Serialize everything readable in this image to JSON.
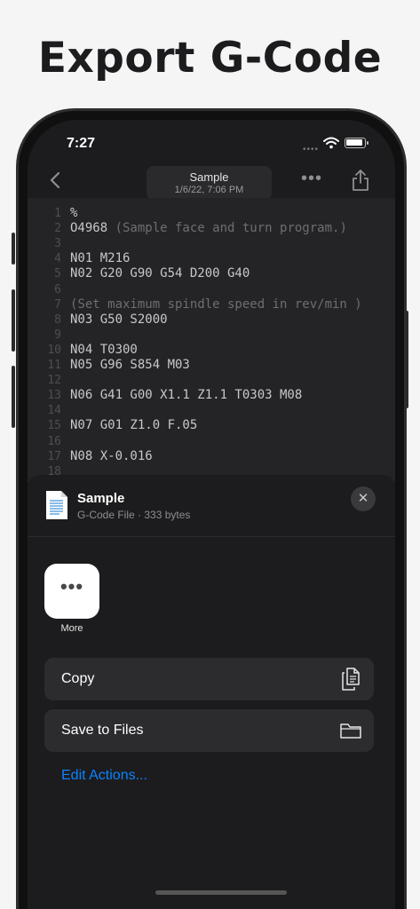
{
  "headline": "Export G-Code",
  "status": {
    "time": "7:27"
  },
  "nav": {
    "doc_title": "Sample",
    "doc_date": "1/6/22, 7:06 PM",
    "more": "•••"
  },
  "code_lines": [
    {
      "n": "1",
      "code": "%",
      "comment": ""
    },
    {
      "n": "2",
      "code": "O4968 ",
      "comment": "(Sample face and turn program.)"
    },
    {
      "n": "3",
      "code": "",
      "comment": ""
    },
    {
      "n": "4",
      "code": "N01 M216",
      "comment": ""
    },
    {
      "n": "5",
      "code": "N02 G20 G90 G54 D200 G40",
      "comment": ""
    },
    {
      "n": "6",
      "code": "",
      "comment": ""
    },
    {
      "n": "7",
      "code": "",
      "comment": "(Set maximum spindle speed in rev/min )"
    },
    {
      "n": "8",
      "code": "N03 G50 S2000",
      "comment": ""
    },
    {
      "n": "9",
      "code": "",
      "comment": ""
    },
    {
      "n": "10",
      "code": "N04 T0300",
      "comment": ""
    },
    {
      "n": "11",
      "code": "N05 G96 S854 M03",
      "comment": ""
    },
    {
      "n": "12",
      "code": "",
      "comment": ""
    },
    {
      "n": "13",
      "code": "N06 G41 G00 X1.1 Z1.1 T0303 M08",
      "comment": ""
    },
    {
      "n": "14",
      "code": "",
      "comment": ""
    },
    {
      "n": "15",
      "code": "N07 G01 Z1.0 F.05",
      "comment": ""
    },
    {
      "n": "16",
      "code": "",
      "comment": ""
    },
    {
      "n": "17",
      "code": "N08 X-0.016",
      "comment": ""
    },
    {
      "n": "18",
      "code": "",
      "comment": ""
    }
  ],
  "sheet": {
    "title": "Sample",
    "subtitle": "G-Code File · 333 bytes",
    "close_glyph": "✕",
    "apps": [
      {
        "label": "More",
        "glyph": "•••"
      }
    ],
    "actions": [
      {
        "label": "Copy",
        "icon": "copy-icon"
      },
      {
        "label": "Save to Files",
        "icon": "folder-icon"
      }
    ],
    "edit_actions": "Edit Actions..."
  },
  "colors": {
    "accent": "#0a84ff",
    "sheet_bg": "#1c1c1e",
    "row_bg": "#2c2c2e"
  }
}
